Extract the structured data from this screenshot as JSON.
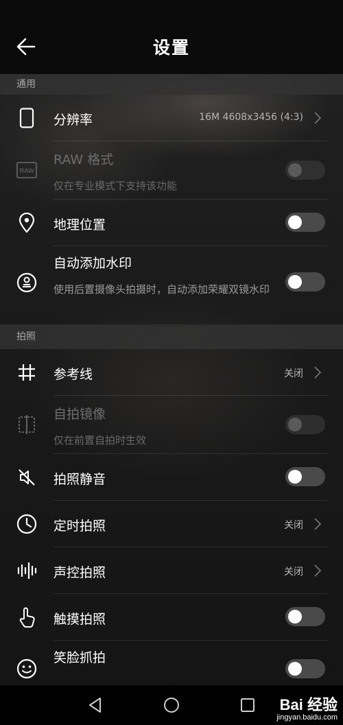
{
  "header": {
    "title": "设置"
  },
  "sections": {
    "general": "通用",
    "photo": "拍照"
  },
  "settings": {
    "resolution": {
      "label": "分辨率",
      "value": "16M 4608x3456 (4:3)"
    },
    "raw": {
      "label": "RAW 格式",
      "sub": "仅在专业模式下支持该功能",
      "enabled": false,
      "on": false
    },
    "location": {
      "label": "地理位置",
      "on": false
    },
    "watermark": {
      "label": "自动添加水印",
      "sub": "使用后置摄像头拍摄时，自动添加荣耀双镜水印",
      "on": false
    },
    "grid": {
      "label": "参考线",
      "value": "关闭"
    },
    "mirror": {
      "label": "自拍镜像",
      "sub": "仅在前置自拍时生效",
      "enabled": false,
      "on": false
    },
    "mute": {
      "label": "拍照静音",
      "on": false
    },
    "timer": {
      "label": "定时拍照",
      "value": "关闭"
    },
    "voice": {
      "label": "声控拍照",
      "value": "关闭"
    },
    "touch": {
      "label": "触摸拍照",
      "on": false
    },
    "smile": {
      "label": "笑脸抓拍",
      "on": false
    }
  },
  "icons": {
    "back": "arrow-left-icon",
    "resolution": "phone-outline-icon",
    "raw": "raw-icon",
    "location": "location-pin-icon",
    "watermark": "stamp-icon",
    "grid": "grid-hash-icon",
    "mirror": "mirror-icon",
    "mute": "speaker-muted-icon",
    "timer": "clock-icon",
    "voice": "soundwave-icon",
    "touch": "touch-hand-icon",
    "smile": "smiley-icon"
  },
  "watermark_logo": {
    "brand": "Bai 经验",
    "url": "jingyan.baidu.com"
  },
  "colors": {
    "header_bg": "#0b0b0b",
    "section_bg": "#323232",
    "toggle_off": "#4a4a4a"
  }
}
